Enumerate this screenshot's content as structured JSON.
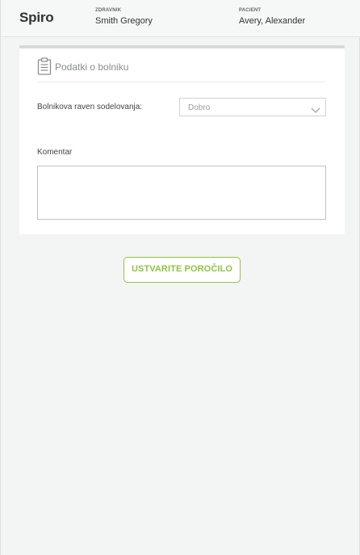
{
  "header": {
    "logo": "Spiro",
    "clinician_label": "ZDRAVNIK",
    "clinician_name": "Smith Gregory",
    "patient_label": "PACIENT",
    "patient_name": "Avery, Alexander"
  },
  "card": {
    "icon": "clipboard-icon",
    "title": "Podatki o bolniku",
    "cooperation_label": "Bolnikova raven sodelovanja:",
    "cooperation_value": "Dobro",
    "comment_label": "Komentar",
    "comment_value": ""
  },
  "actions": {
    "create_report": "USTVARITE POROČILO"
  },
  "colors": {
    "accent": "#8cc63f",
    "background": "#f3f4f4"
  }
}
